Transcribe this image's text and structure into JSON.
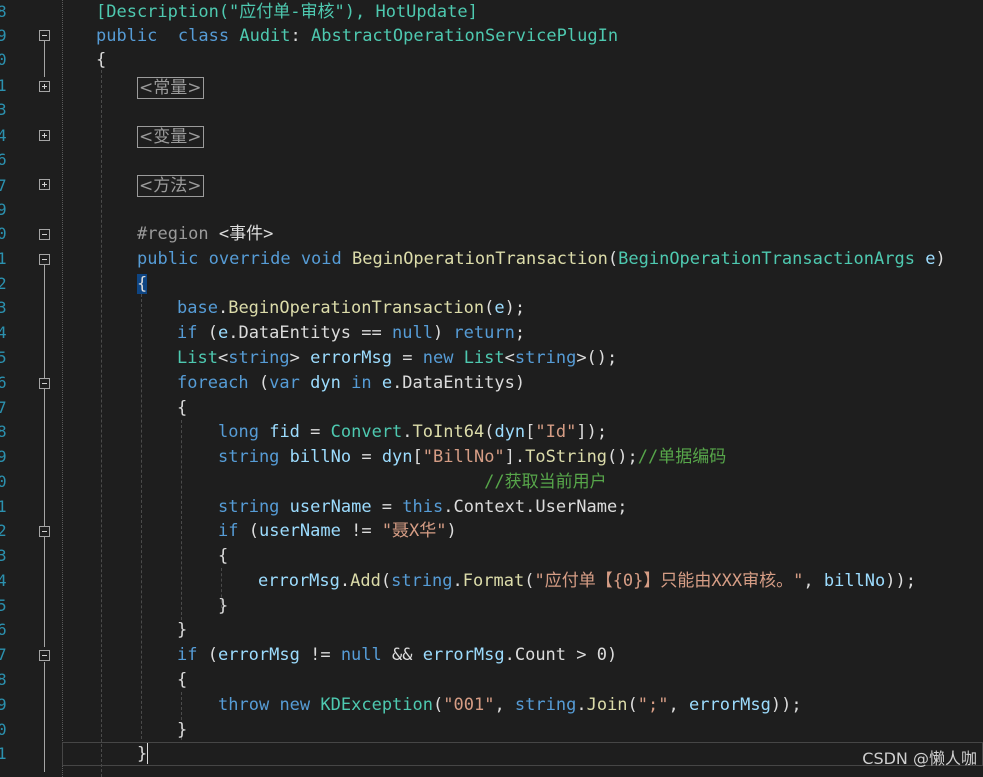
{
  "editor": {
    "line_numbers": [
      "8",
      "9",
      "0",
      "1",
      "3",
      "4",
      "6",
      "7",
      "9",
      "0",
      "1",
      "2",
      "3",
      "4",
      "5",
      "6",
      "7",
      "8",
      "9",
      "0",
      "1",
      "2",
      "3",
      "4",
      "5",
      "6",
      "7",
      "8",
      "9",
      "0",
      "1"
    ],
    "lines": [
      [
        {
          "c": "ty",
          "t": "[Description(\"应付单-审核\"), HotUpdate]"
        }
      ],
      [
        {
          "c": "kw",
          "t": "public"
        },
        {
          "c": "pl",
          "t": "  "
        },
        {
          "c": "kw",
          "t": "class"
        },
        {
          "c": "pl",
          "t": " "
        },
        {
          "c": "ty",
          "t": "Audit"
        },
        {
          "c": "pl",
          "t": ": "
        },
        {
          "c": "ty",
          "t": "AbstractOperationServicePlugIn"
        }
      ],
      [
        {
          "c": "pl",
          "t": "{"
        }
      ],
      [],
      [],
      [],
      [],
      [],
      [],
      [
        {
          "c": "pp",
          "t": "#region"
        },
        {
          "c": "pl",
          "t": " <事件>"
        }
      ],
      [
        {
          "c": "kw",
          "t": "public"
        },
        {
          "c": "pl",
          "t": " "
        },
        {
          "c": "kw",
          "t": "override"
        },
        {
          "c": "pl",
          "t": " "
        },
        {
          "c": "kw",
          "t": "void"
        },
        {
          "c": "pl",
          "t": " "
        },
        {
          "c": "fn",
          "t": "BeginOperationTransaction"
        },
        {
          "c": "pl",
          "t": "("
        },
        {
          "c": "ty",
          "t": "BeginOperationTransactionArgs"
        },
        {
          "c": "pl",
          "t": " "
        },
        {
          "c": "vr",
          "t": "e"
        },
        {
          "c": "pl",
          "t": ")"
        }
      ],
      [
        {
          "c": "brace-hl",
          "t": "{"
        }
      ],
      [
        {
          "c": "kw",
          "t": "base"
        },
        {
          "c": "pl",
          "t": "."
        },
        {
          "c": "fn",
          "t": "BeginOperationTransaction"
        },
        {
          "c": "pl",
          "t": "("
        },
        {
          "c": "vr",
          "t": "e"
        },
        {
          "c": "pl",
          "t": ");"
        }
      ],
      [
        {
          "c": "kw",
          "t": "if"
        },
        {
          "c": "pl",
          "t": " ("
        },
        {
          "c": "vr",
          "t": "e"
        },
        {
          "c": "pl",
          "t": ".DataEntitys == "
        },
        {
          "c": "kw",
          "t": "null"
        },
        {
          "c": "pl",
          "t": ") "
        },
        {
          "c": "kw",
          "t": "return"
        },
        {
          "c": "pl",
          "t": ";"
        }
      ],
      [
        {
          "c": "ty",
          "t": "List"
        },
        {
          "c": "pl",
          "t": "<"
        },
        {
          "c": "kw",
          "t": "string"
        },
        {
          "c": "pl",
          "t": "> "
        },
        {
          "c": "vr",
          "t": "errorMsg"
        },
        {
          "c": "pl",
          "t": " = "
        },
        {
          "c": "kw",
          "t": "new"
        },
        {
          "c": "pl",
          "t": " "
        },
        {
          "c": "ty",
          "t": "List"
        },
        {
          "c": "pl",
          "t": "<"
        },
        {
          "c": "kw",
          "t": "string"
        },
        {
          "c": "pl",
          "t": ">();"
        }
      ],
      [
        {
          "c": "kw",
          "t": "foreach"
        },
        {
          "c": "pl",
          "t": " ("
        },
        {
          "c": "kw",
          "t": "var"
        },
        {
          "c": "pl",
          "t": " "
        },
        {
          "c": "vr",
          "t": "dyn"
        },
        {
          "c": "pl",
          "t": " "
        },
        {
          "c": "kw",
          "t": "in"
        },
        {
          "c": "pl",
          "t": " "
        },
        {
          "c": "vr",
          "t": "e"
        },
        {
          "c": "pl",
          "t": ".DataEntitys)"
        }
      ],
      [
        {
          "c": "pl",
          "t": "{"
        }
      ],
      [
        {
          "c": "kw",
          "t": "long"
        },
        {
          "c": "pl",
          "t": " "
        },
        {
          "c": "vr",
          "t": "fid"
        },
        {
          "c": "pl",
          "t": " = "
        },
        {
          "c": "ty",
          "t": "Convert"
        },
        {
          "c": "pl",
          "t": "."
        },
        {
          "c": "fn",
          "t": "ToInt64"
        },
        {
          "c": "pl",
          "t": "("
        },
        {
          "c": "vr",
          "t": "dyn"
        },
        {
          "c": "pl",
          "t": "["
        },
        {
          "c": "st",
          "t": "\"Id\""
        },
        {
          "c": "pl",
          "t": "]);"
        }
      ],
      [
        {
          "c": "kw",
          "t": "string"
        },
        {
          "c": "pl",
          "t": " "
        },
        {
          "c": "vr",
          "t": "billNo"
        },
        {
          "c": "pl",
          "t": " = "
        },
        {
          "c": "vr",
          "t": "dyn"
        },
        {
          "c": "pl",
          "t": "["
        },
        {
          "c": "st",
          "t": "\"BillNo\""
        },
        {
          "c": "pl",
          "t": "]."
        },
        {
          "c": "fn",
          "t": "ToString"
        },
        {
          "c": "pl",
          "t": "();"
        },
        {
          "c": "cm",
          "t": "//单据编码"
        }
      ],
      [
        {
          "c": "pl",
          "t": "                          "
        },
        {
          "c": "cm",
          "t": "//获取当前用户"
        }
      ],
      [
        {
          "c": "kw",
          "t": "string"
        },
        {
          "c": "pl",
          "t": " "
        },
        {
          "c": "vr",
          "t": "userName"
        },
        {
          "c": "pl",
          "t": " = "
        },
        {
          "c": "kw",
          "t": "this"
        },
        {
          "c": "pl",
          "t": ".Context.UserName;"
        }
      ],
      [
        {
          "c": "kw",
          "t": "if"
        },
        {
          "c": "pl",
          "t": " ("
        },
        {
          "c": "vr",
          "t": "userName"
        },
        {
          "c": "pl",
          "t": " != "
        },
        {
          "c": "st",
          "t": "\"聂X华\""
        },
        {
          "c": "pl",
          "t": ")"
        }
      ],
      [
        {
          "c": "pl",
          "t": "{"
        }
      ],
      [
        {
          "c": "vr",
          "t": "errorMsg"
        },
        {
          "c": "pl",
          "t": "."
        },
        {
          "c": "fn",
          "t": "Add"
        },
        {
          "c": "pl",
          "t": "("
        },
        {
          "c": "kw",
          "t": "string"
        },
        {
          "c": "pl",
          "t": "."
        },
        {
          "c": "fn",
          "t": "Format"
        },
        {
          "c": "pl",
          "t": "("
        },
        {
          "c": "st",
          "t": "\"应付单【{0}】只能由XXX审核。\""
        },
        {
          "c": "pl",
          "t": ", "
        },
        {
          "c": "vr",
          "t": "billNo"
        },
        {
          "c": "pl",
          "t": "));"
        }
      ],
      [
        {
          "c": "pl",
          "t": "}"
        }
      ],
      [
        {
          "c": "pl",
          "t": "}"
        }
      ],
      [
        {
          "c": "kw",
          "t": "if"
        },
        {
          "c": "pl",
          "t": " ("
        },
        {
          "c": "vr",
          "t": "errorMsg"
        },
        {
          "c": "pl",
          "t": " != "
        },
        {
          "c": "kw",
          "t": "null"
        },
        {
          "c": "pl",
          "t": " && "
        },
        {
          "c": "vr",
          "t": "errorMsg"
        },
        {
          "c": "pl",
          "t": ".Count > 0)"
        }
      ],
      [
        {
          "c": "pl",
          "t": "{"
        }
      ],
      [
        {
          "c": "kw",
          "t": "throw"
        },
        {
          "c": "pl",
          "t": " "
        },
        {
          "c": "kw",
          "t": "new"
        },
        {
          "c": "pl",
          "t": " "
        },
        {
          "c": "ty",
          "t": "KDException"
        },
        {
          "c": "pl",
          "t": "("
        },
        {
          "c": "st",
          "t": "\"001\""
        },
        {
          "c": "pl",
          "t": ", "
        },
        {
          "c": "kw",
          "t": "string"
        },
        {
          "c": "pl",
          "t": "."
        },
        {
          "c": "fn",
          "t": "Join"
        },
        {
          "c": "pl",
          "t": "("
        },
        {
          "c": "st",
          "t": "\";\""
        },
        {
          "c": "pl",
          "t": ", "
        },
        {
          "c": "vr",
          "t": "errorMsg"
        },
        {
          "c": "pl",
          "t": "));"
        }
      ],
      [
        {
          "c": "pl",
          "t": "}"
        }
      ],
      [
        {
          "c": "pl",
          "t": "}"
        }
      ]
    ],
    "collapsed_regions": [
      "<常量>",
      "<变量>",
      "<方法>"
    ]
  },
  "watermark": "CSDN @懒人咖"
}
